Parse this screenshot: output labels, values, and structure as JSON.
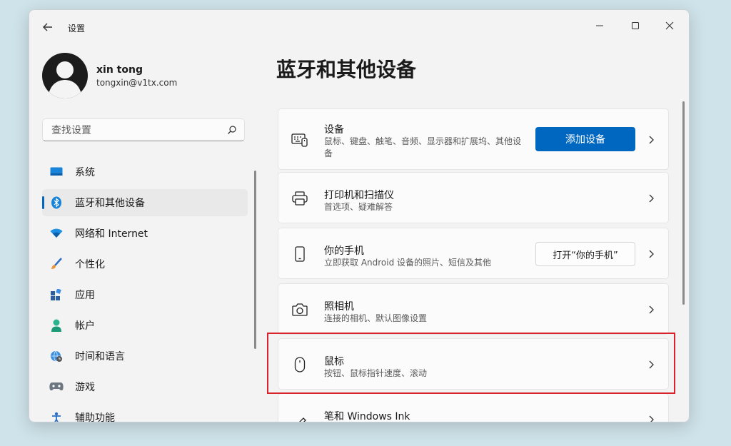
{
  "window": {
    "title": "设置"
  },
  "profile": {
    "name": "xin tong",
    "email": "tongxin@v1tx.com"
  },
  "search": {
    "placeholder": "查找设置"
  },
  "sidebar": {
    "items": [
      {
        "label": "系统",
        "icon": "monitor-icon"
      },
      {
        "label": "蓝牙和其他设备",
        "icon": "bluetooth-icon",
        "active": true
      },
      {
        "label": "网络和 Internet",
        "icon": "wifi-icon"
      },
      {
        "label": "个性化",
        "icon": "brush-icon"
      },
      {
        "label": "应用",
        "icon": "apps-icon"
      },
      {
        "label": "帐户",
        "icon": "person-icon"
      },
      {
        "label": "时间和语言",
        "icon": "globe-clock-icon"
      },
      {
        "label": "游戏",
        "icon": "gamepad-icon"
      },
      {
        "label": "辅助功能",
        "icon": "accessibility-icon"
      }
    ]
  },
  "main": {
    "title": "蓝牙和其他设备",
    "cards": [
      {
        "title": "设备",
        "desc": "鼠标、键盘、触笔、音频、显示器和扩展坞、其他设备",
        "button": "添加设备",
        "icon": "devices-icon"
      },
      {
        "title": "打印机和扫描仪",
        "desc": "首选项、疑难解答",
        "icon": "printer-icon"
      },
      {
        "title": "你的手机",
        "desc": "立即获取 Android 设备的照片、短信及其他",
        "button": "打开“你的手机”",
        "icon": "phone-icon"
      },
      {
        "title": "照相机",
        "desc": "连接的相机、默认图像设置",
        "icon": "camera-icon"
      },
      {
        "title": "鼠标",
        "desc": "按钮、鼠标指针速度、滚动",
        "icon": "mouse-icon"
      },
      {
        "title": "笔和 Windows Ink",
        "desc": "",
        "icon": "pen-icon"
      }
    ]
  },
  "colors": {
    "accent": "#0067c0",
    "highlight": "#d8232a"
  }
}
